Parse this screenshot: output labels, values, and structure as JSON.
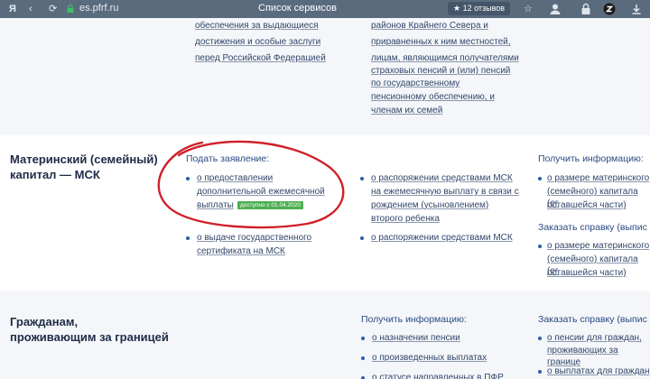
{
  "browser": {
    "address": "es.pfrf.ru",
    "title": "Список сервисов",
    "reviews": "★ 12 отзывов",
    "icons": [
      "yandex-logo-icon",
      "back-icon",
      "refresh-icon",
      "lock-icon",
      "star-icon",
      "user-icon",
      "lock-icon",
      "z-extension-icon",
      "download-icon"
    ]
  },
  "top_section": {
    "col1_lines": [
      "обеспечения за выдающиеся",
      "достижения и особые заслуги",
      "перед Российской Федерацией"
    ],
    "col2_lines": [
      "районов Крайнего Севера и",
      "приравненных к ним местностей,",
      "лицам, являющимся получателями",
      "страховых пенсий и (или) пенсий",
      "по государственному",
      "пенсионному обеспечению, и",
      "членам их семей"
    ]
  },
  "msk_section": {
    "heading_lines": [
      "Материнский (семейный)",
      "капитал — МСК"
    ],
    "apply_label": "Подать заявление:",
    "apply_link_lines": [
      "о предоставлении",
      "дополнительной ежемесячной",
      "выплаты"
    ],
    "apply_badge": "доступно с 01.04.2020",
    "certificate_link_lines": [
      "о выдаче государственного",
      "сертификата на МСК"
    ],
    "disposal_link_lines": [
      "о распоряжении средствами МСК",
      "на ежемесячную выплату в связи с",
      "рождением (усыновлением)",
      "второго ребенка"
    ],
    "disposal_link2": "о распоряжении средствами МСК",
    "info_label": "Получить информацию:",
    "info_link_lines": [
      "о размере материнского",
      "(семейного) капитала (ег",
      "оставшейся части)"
    ],
    "certificate_label": "Заказать справку (выпис",
    "certificate2_link_lines": [
      "о размере материнского",
      "(семейного) капитала (ег",
      "оставшейся части)"
    ]
  },
  "abroad_section": {
    "heading_lines": [
      "Гражданам,",
      "проживающим за границей"
    ],
    "info_label": "Получить информацию:",
    "info_links": [
      "о назначении пенсии",
      "о произведенных выплатах",
      "о статусе направленных в ПФР"
    ],
    "cert_label": "Заказать справку (выпис",
    "cert_link_lines": [
      "о пенсии для граждан,",
      "проживающих за границе"
    ],
    "cert_link2": "о выплатах для граждан"
  },
  "colors": {
    "accent": "#2a5db0",
    "badge": "#4caf50",
    "annotation": "#d0202a"
  }
}
